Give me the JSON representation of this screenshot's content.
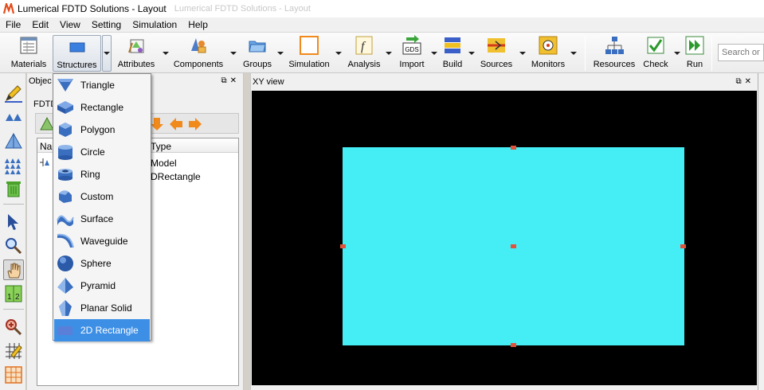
{
  "window": {
    "title": "Lumerical FDTD Solutions - Layout",
    "ghost_title": "Lumerical FDTD Solutions - Layout"
  },
  "menubar": [
    "File",
    "Edit",
    "View",
    "Setting",
    "Simulation",
    "Help"
  ],
  "toolbar": {
    "buttons": [
      {
        "label": "Materials",
        "icon": "materials-icon"
      },
      {
        "label": "Structures",
        "icon": "structures-icon"
      },
      {
        "label": "Attributes",
        "icon": "attributes-icon"
      },
      {
        "label": "Components",
        "icon": "components-icon"
      },
      {
        "label": "Groups",
        "icon": "groups-icon"
      },
      {
        "label": "Simulation",
        "icon": "simulation-icon"
      },
      {
        "label": "Analysis",
        "icon": "analysis-icon"
      },
      {
        "label": "Import",
        "icon": "import-gds-icon",
        "icon_text": "GDS"
      },
      {
        "label": "Build",
        "icon": "build-icon"
      },
      {
        "label": "Sources",
        "icon": "sources-icon"
      },
      {
        "label": "Monitors",
        "icon": "monitors-icon"
      },
      {
        "label": "Resources",
        "icon": "resources-icon"
      },
      {
        "label": "Check",
        "icon": "check-icon"
      },
      {
        "label": "Run",
        "icon": "run-icon"
      }
    ],
    "search_placeholder": "Search onli"
  },
  "objects_panel": {
    "title": "Objec",
    "subtitle": "FDTD",
    "tree": {
      "columns": [
        "Nam",
        "Type"
      ],
      "rows": [
        {
          "type": "Model"
        },
        {
          "type": "DRectangle"
        }
      ]
    }
  },
  "xy_panel": {
    "title": "XY view",
    "rect_color": "#45eef5",
    "handle_color": "#e0543d"
  },
  "structures_menu": {
    "items": [
      {
        "label": "Triangle",
        "icon": "triangle-icon"
      },
      {
        "label": "Rectangle",
        "icon": "rectangle-icon"
      },
      {
        "label": "Polygon",
        "icon": "polygon-icon"
      },
      {
        "label": "Circle",
        "icon": "circle-icon"
      },
      {
        "label": "Ring",
        "icon": "ring-icon"
      },
      {
        "label": "Custom",
        "icon": "custom-icon"
      },
      {
        "label": "Surface",
        "icon": "surface-icon"
      },
      {
        "label": "Waveguide",
        "icon": "waveguide-icon"
      },
      {
        "label": "Sphere",
        "icon": "sphere-icon"
      },
      {
        "label": "Pyramid",
        "icon": "pyramid-icon"
      },
      {
        "label": "Planar Solid",
        "icon": "planar-solid-icon"
      },
      {
        "label": "2D Rectangle",
        "icon": "2d-rectangle-icon",
        "selected": true
      }
    ],
    "selection_color": "#3d8fe6"
  }
}
